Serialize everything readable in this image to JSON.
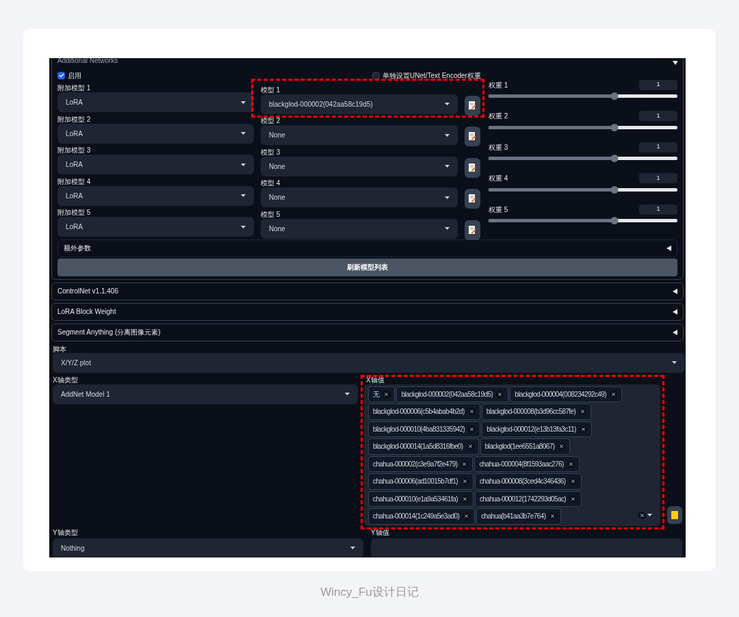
{
  "panel": {
    "title": "Additional Networks",
    "enable": {
      "label": "启用",
      "checked": true
    },
    "separate": {
      "label": "单独设置UNet/Text Encoder权重",
      "checked": false
    },
    "slots": [
      {
        "type_label": "附加模型 1",
        "type_value": "LoRA",
        "model_label": "模型 1",
        "model_value": "blackglod-000002(042aa58c19d5)",
        "highlighted": true,
        "weight_label": "权重 1",
        "weight_value": "1",
        "level": 0.667
      },
      {
        "type_label": "附加模型 2",
        "type_value": "LoRA",
        "model_label": "模型 2",
        "model_value": "None",
        "highlighted": false,
        "weight_label": "权重 2",
        "weight_value": "1",
        "level": 0.667
      },
      {
        "type_label": "附加模型 3",
        "type_value": "LoRA",
        "model_label": "模型 3",
        "model_value": "None",
        "highlighted": false,
        "weight_label": "权重 3",
        "weight_value": "1",
        "level": 0.667
      },
      {
        "type_label": "附加模型 4",
        "type_value": "LoRA",
        "model_label": "模型 4",
        "model_value": "None",
        "highlighted": false,
        "weight_label": "权重 4",
        "weight_value": "1",
        "level": 0.667
      },
      {
        "type_label": "附加模型 5",
        "type_value": "LoRA",
        "model_label": "模型 5",
        "model_value": "None",
        "highlighted": false,
        "weight_label": "权重 5",
        "weight_value": "1",
        "level": 0.667
      }
    ],
    "extra": {
      "label": "额外参数",
      "expanded": false
    },
    "refresh_button": "刷新模型列表"
  },
  "accordions": [
    {
      "label": "ControlNet v1.1.406",
      "expanded": false
    },
    {
      "label": "LoRA Block Weight",
      "expanded": false
    },
    {
      "label": "Segment Anything (分离图像元素)",
      "expanded": false
    }
  ],
  "script": {
    "label": "脚本",
    "value": "X/Y/Z plot"
  },
  "x_type": {
    "label": "X轴类型",
    "value": "AddNet Model 1"
  },
  "x_values": {
    "label": "X轴值",
    "highlighted": true,
    "tags": [
      "无",
      "blackglod-000002(042aa58c19d5)",
      "blackglod-000004(008234292c49)",
      "blackglod-000006(c5b4abab4b2d)",
      "blackglod-000008(b3d96cc587fe)",
      "blackglod-000010(4ba831335942)",
      "blackglod-000012(e13b13fa3c11)",
      "blackglod-000014(1a5d8316fbe0)",
      "blackglod(1ee6551a8067)",
      "chahua-000002(c3e9a7f2e479)",
      "chahua-000004(8f1593aac276)",
      "chahua-000006(ad10015b7df1)",
      "chahua-000008(3ced4c346436)",
      "chahua-000010(e1a9a53461fa)",
      "chahua-000012(1742293d05ac)",
      "chahua-000014(1c249a5e3ad0)",
      "chahua(b41aa3b7e764)"
    ]
  },
  "y_type": {
    "label": "Y轴类型",
    "value": "Nothing"
  },
  "y_values": {
    "label": "Y轴值"
  },
  "caption": "Wincy_Fu设计日记"
}
